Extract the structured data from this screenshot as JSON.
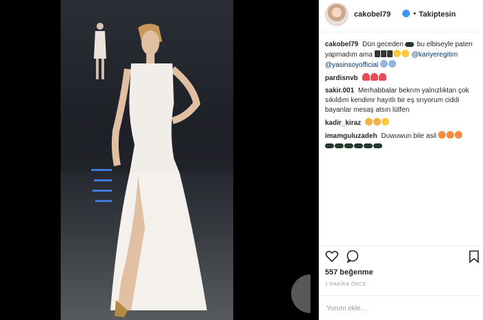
{
  "post": {
    "username": "cakobel79",
    "separator": "•",
    "follow_status": "Takiptesin"
  },
  "comments": [
    {
      "user": "cakobel79",
      "text_a": "Dün geceden",
      "text_b": "bu elbiseyle paten yapmadım ama",
      "mention1": "@kariyeregitim",
      "mention2": "@yasinsoyofficial"
    },
    {
      "user": "pardisnvb"
    },
    {
      "user": "sakir.001",
      "text": "Merhabbalar bekrım yalnızlıktan çok sıkıldım kendimr hayıtlı bir eş srıyorum ciddi bayanlar mesaş atsın lütfen"
    },
    {
      "user": "kadir_kiraz"
    },
    {
      "user": "imamguluzadeh",
      "text": "Duwuwun bile asil"
    }
  ],
  "stats": {
    "likes": "557 beğenme",
    "time": "1 DAKİKA ÖNCE"
  },
  "input": {
    "placeholder": "Yorum ekle..."
  },
  "icons": {
    "verified": "verified-badge-icon",
    "like": "heart-icon",
    "comment": "comment-icon",
    "save": "bookmark-icon"
  },
  "colors": {
    "verified": "#3897f0",
    "heart": "#ed4956",
    "text": "#262626",
    "muted": "#999999"
  }
}
